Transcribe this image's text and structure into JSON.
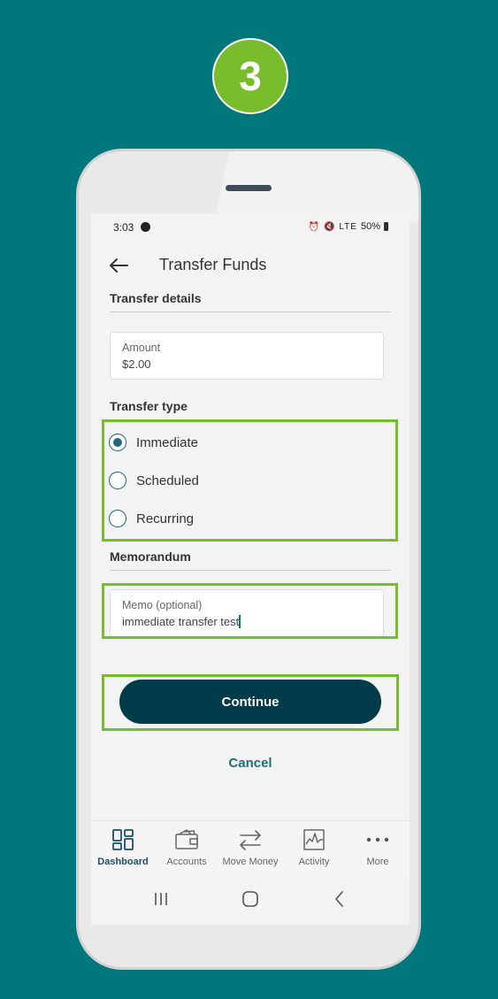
{
  "step": {
    "number": "3"
  },
  "colors": {
    "background": "#00777b",
    "highlight": "#78bb2b",
    "primary": "#003b4a",
    "accent": "#1e6f78"
  },
  "status_bar": {
    "time": "3:03",
    "icons": "⏰ 🔇 LTE ",
    "battery": "50%"
  },
  "app_bar": {
    "title": "Transfer Funds",
    "back_icon": "arrow-left-icon"
  },
  "transfer_details": {
    "title": "Transfer details",
    "amount": {
      "label": "Amount",
      "value": "$2.00"
    }
  },
  "transfer_type": {
    "title": "Transfer type",
    "options": [
      {
        "label": "Immediate",
        "selected": true
      },
      {
        "label": "Scheduled",
        "selected": false
      },
      {
        "label": "Recurring",
        "selected": false
      }
    ]
  },
  "memorandum": {
    "title": "Memorandum",
    "memo": {
      "label": "Memo (optional)",
      "value": "immediate transfer test"
    }
  },
  "actions": {
    "continue_label": "Continue",
    "cancel_label": "Cancel"
  },
  "bottom_nav": {
    "items": [
      {
        "label": "Dashboard",
        "icon": "dashboard-icon",
        "active": true
      },
      {
        "label": "Accounts",
        "icon": "wallet-icon",
        "active": false
      },
      {
        "label": "Move Money",
        "icon": "transfer-arrows-icon",
        "active": false
      },
      {
        "label": "Activity",
        "icon": "activity-chart-icon",
        "active": false
      },
      {
        "label": "More",
        "icon": "more-dots-icon",
        "active": false
      }
    ]
  },
  "system_nav": {
    "icons": [
      "recents-icon",
      "home-icon",
      "back-icon"
    ]
  }
}
